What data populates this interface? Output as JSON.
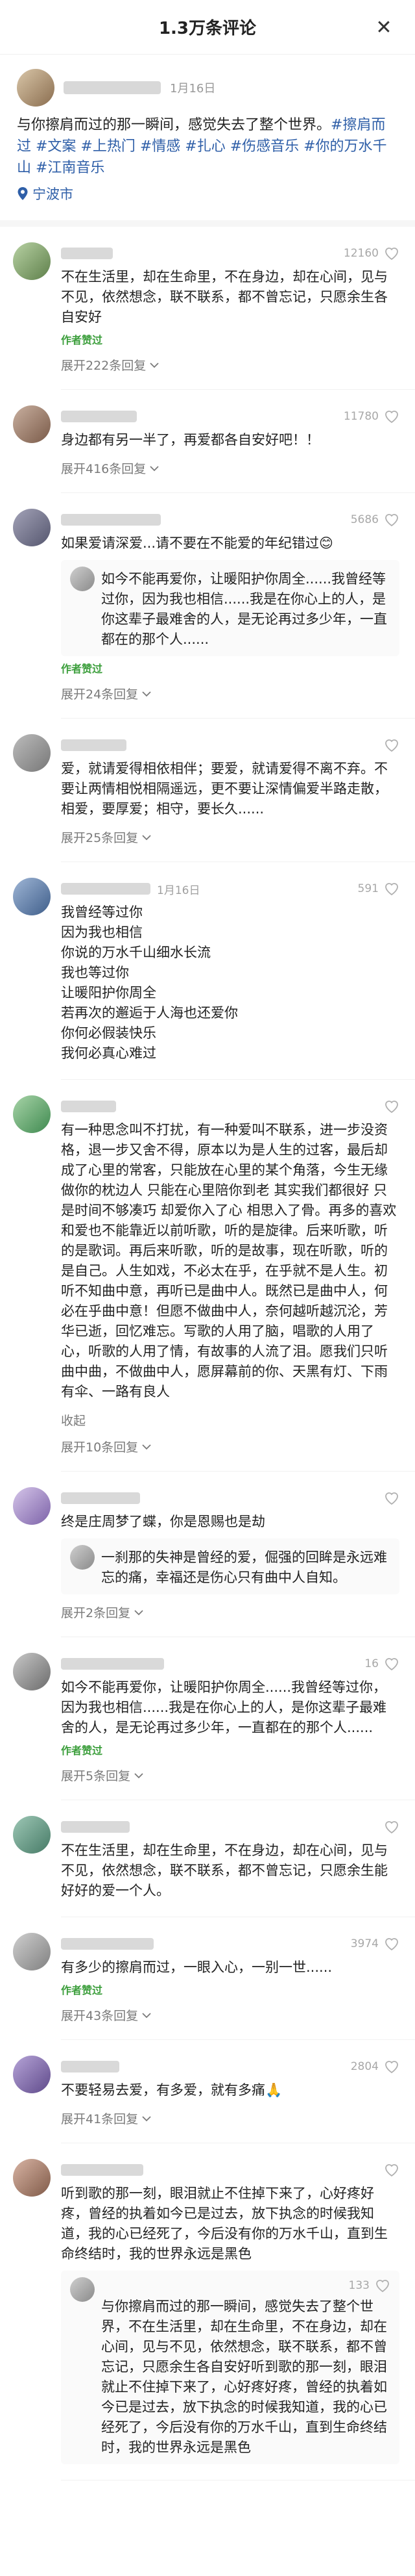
{
  "header": {
    "title": "1.3万条评论",
    "close_icon": "close-icon"
  },
  "post": {
    "date": "1月16日",
    "text": "与你擦肩而过的那一瞬间，感觉失去了整个世界。",
    "hashtags": "#擦肩而过 #文案 #上热门 #情感 #扎心 #伤感音乐 #你的万水千山 #江南音乐",
    "location": "宁波市"
  },
  "comments": [
    {
      "date": "",
      "likes": "12160",
      "text": "不在生活里，却在生命里，不在身边，却在心间，见与不见，依然想念，联不联系，都不曾忘记，只愿余生各自安好",
      "author_liked": "作者赞过",
      "expand": "展开222条回复"
    },
    {
      "date": "",
      "likes": "11780",
      "text": "身边都有另一半了，再爱都各自安好吧！！",
      "author_liked": "",
      "expand": "展开416条回复"
    },
    {
      "date": "",
      "likes": "5686",
      "text": "如果爱请深爱...请不要在不能爱的年纪错过😊",
      "reply_text": "如今不能再爱你，让暖阳护你周全......我曾经等过你，因为我也相信......我是在你心上的人，是你这辈子最难舍的人，是无论再过多少年，一直都在的那个人......",
      "author_liked": "作者赞过",
      "expand": "展开24条回复"
    },
    {
      "date": "",
      "likes": "",
      "text": "爱，就请爱得相依相伴；要爱，就请爱得不离不弃。不要让两情相悦相隔遥远，更不要让深情偏爱半路走散，相爱，要厚爱；相守，要长久......",
      "author_liked": "",
      "expand": "展开25条回复"
    },
    {
      "date": "1月16日",
      "likes": "591",
      "text": "我曾经等过你\n因为我也相信\n你说的万水千山细水长流\n我也等过你\n让暖阳护你周全\n若再次的邂逅于人海也还爱你\n你何必假装快乐\n我何必真心难过",
      "author_liked": "",
      "expand": ""
    },
    {
      "date": "",
      "likes": "",
      "text": "有一种思念叫不打扰，有一种爱叫不联系，进一步没资格，退一步又舍不得，原本以为是人生的过客，最后却成了心里的常客，只能放在心里的某个角落，今生无缘做你的枕边人 只能在心里陪你到老 其实我们都很好 只是时间不够凑巧 却爱你入了心 相思入了骨。再多的喜欢和爱也不能靠近以前听歌，听的是旋律。后来听歌，听的是歌词。再后来听歌，听的是故事，现在听歌，听的是自己。人生如戏，不必太在乎，在乎就不是人生。初听不知曲中意，再听已是曲中人。既然已是曲中人，何必在乎曲中意！但愿不做曲中人，奈何越听越沉沦，芳华已逝，回忆难忘。写歌的人用了脑，唱歌的人用了心，听歌的人用了情，有故事的人流了泪。愿我们只听曲中曲，不做曲中人，愿屏幕前的你、天黑有灯、下雨有伞、一路有良人",
      "collapse": "收起",
      "author_liked": "",
      "expand": "展开10条回复"
    },
    {
      "date": "",
      "likes": "",
      "text": "终是庄周梦了蝶，你是恩赐也是劫",
      "reply_text": "一刹那的失神是曾经的爱，倔强的回眸是永远难忘的痛，幸福还是伤心只有曲中人自知。",
      "author_liked": "",
      "expand": "展开2条回复"
    },
    {
      "date": "",
      "likes": "16",
      "text": "如今不能再爱你，让暖阳护你周全......我曾经等过你，因为我也相信......我是在你心上的人，是你这辈子最难舍的人，是无论再过多少年，一直都在的那个人......",
      "author_liked": "作者赞过",
      "expand": "展开5条回复"
    },
    {
      "date": "",
      "likes": "",
      "text": "不在生活里，却在生命里，不在身边，却在心间，见与不见，依然想念，联不联系，都不曾忘记，只愿余生能好好的爱一个人。",
      "author_liked": "",
      "expand": ""
    },
    {
      "date": "",
      "likes": "3974",
      "text": "有多少的擦肩而过，一眼入心，一别一世......",
      "author_liked": "作者赞过",
      "expand": "展开43条回复"
    },
    {
      "date": "",
      "likes": "2804",
      "text": "不要轻易去爱，有多爱，就有多痛🙏",
      "author_liked": "",
      "expand": "展开41条回复"
    },
    {
      "date": "",
      "likes": "",
      "text": "听到歌的那一刻，眼泪就止不住掉下来了，心好疼好疼，曾经的执着如今已是过去，放下执念的时候我知道，我的心已经死了，今后没有你的万水千山，直到生命终结时，我的世界永远是黑色",
      "reply_likes": "133",
      "reply_text": "与你擦肩而过的那一瞬间，感觉失去了整个世界，不在生活里，却在生命里，不在身边，却在心间，见与不见，依然想念，联不联系，都不曾忘记，只愿余生各自安好听到歌的那一刻，眼泪就止不住掉下来了，心好疼好疼，曾经的执着如今已是过去，放下执念的时候我知道，我的心已经死了，今后没有你的万水千山，直到生命终结时，我的世界永远是黑色",
      "author_liked": "",
      "expand": ""
    }
  ]
}
